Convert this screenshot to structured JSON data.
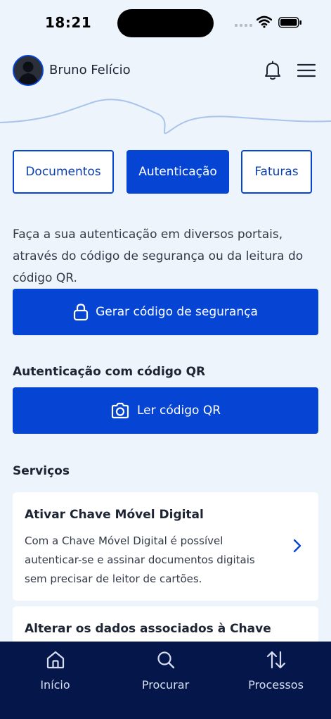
{
  "status_bar": {
    "time": "18:21"
  },
  "header": {
    "user_name": "Bruno Felício"
  },
  "tabs": [
    {
      "label": "Documentos",
      "active": false
    },
    {
      "label": "Autenticação",
      "active": true
    },
    {
      "label": "Faturas",
      "active": false
    }
  ],
  "intro_text": "Faça a sua autenticação em diversos portais, através do código de segurança ou da leitura do código QR.",
  "generate_code_button": {
    "label": "Gerar código de segurança",
    "icon": "lock-icon"
  },
  "qr_section": {
    "title": "Autenticação com código QR",
    "button_label": "Ler código QR",
    "icon": "camera-icon"
  },
  "services": {
    "title": "Serviços",
    "items": [
      {
        "title": "Ativar Chave Móvel Digital",
        "description": "Com a Chave Móvel Digital é possível autenticar-se e assinar documentos digitais sem precisar de leitor de cartões."
      },
      {
        "title": "Alterar os dados associados à Chave",
        "description": ""
      }
    ]
  },
  "bottom_nav": [
    {
      "label": "Início",
      "icon": "home-icon"
    },
    {
      "label": "Procurar",
      "icon": "search-icon"
    },
    {
      "label": "Processos",
      "icon": "arrows-updown-icon"
    }
  ],
  "colors": {
    "primary": "#0645d4",
    "background": "#eef4fb",
    "nav_background": "#04164a",
    "text": "#1d2433"
  }
}
